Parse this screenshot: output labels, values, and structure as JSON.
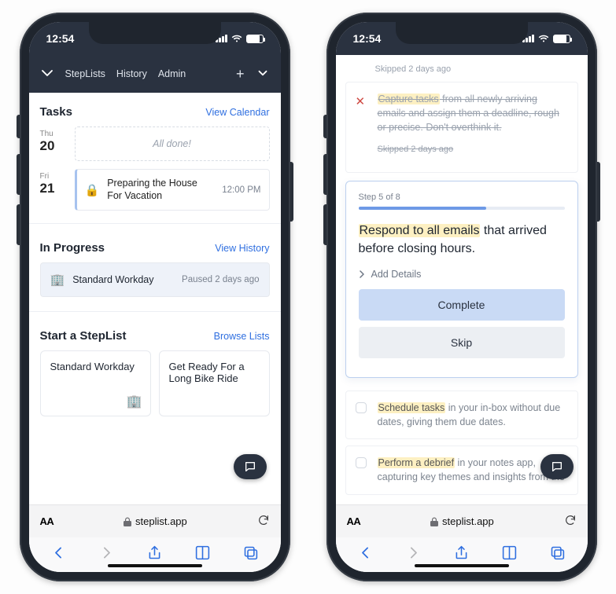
{
  "statusbar": {
    "time": "12:54"
  },
  "nav": {
    "items": [
      "StepLists",
      "History",
      "Admin"
    ]
  },
  "left": {
    "tasks": {
      "heading": "Tasks",
      "link": "View Calendar",
      "days": [
        {
          "dow": "Thu",
          "dom": "20",
          "empty": "All done!"
        },
        {
          "dow": "Fri",
          "dom": "21",
          "emoji": "🔒",
          "title": "Preparing the House For Vacation",
          "time": "12:00 PM"
        }
      ]
    },
    "progress": {
      "heading": "In Progress",
      "link": "View History",
      "item": {
        "emoji": "🏢",
        "title": "Standard Workday",
        "meta": "Paused 2 days ago"
      }
    },
    "start": {
      "heading": "Start a StepList",
      "link": "Browse Lists",
      "tiles": [
        {
          "title": "Standard Workday",
          "emoji": "🏢"
        },
        {
          "title": "Get Ready For a Long Bike Ride",
          "emoji": ""
        }
      ]
    }
  },
  "right": {
    "skipped_top": "Skipped 2 days ago",
    "ghost": {
      "hl": "Capture tasks",
      "rest": " from all newly arriving emails and assign them a deadline, rough or precise. Don't overthink it.",
      "skipped": "Skipped 2 days ago"
    },
    "active": {
      "step_label": "Step 5 of 8",
      "progress_pct": 62,
      "hl": "Respond to all emails",
      "rest": " that arrived before closing hours.",
      "add_details": "Add Details",
      "complete": "Complete",
      "skip": "Skip"
    },
    "future": [
      {
        "hl": "Schedule tasks",
        "rest": " in your in-box without due dates, giving them due dates."
      },
      {
        "hl": "Perform a debrief",
        "rest": " in your notes app, capturing key themes and insights from the"
      }
    ]
  },
  "browser": {
    "url": "steplist.app"
  }
}
